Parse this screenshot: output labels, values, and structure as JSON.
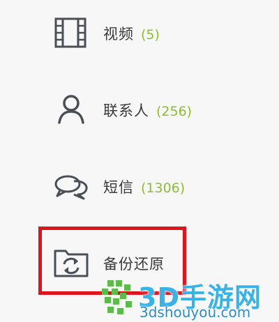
{
  "sidebar": {
    "items": [
      {
        "label": "视频",
        "count": "(5)",
        "icon": "film-icon"
      },
      {
        "label": "联系人",
        "count": "(256)",
        "icon": "person-icon"
      },
      {
        "label": "短信",
        "count": "(1306)",
        "icon": "chat-bubbles-icon"
      },
      {
        "label": "备份还原",
        "count": "",
        "icon": "backup-restore-icon"
      }
    ]
  },
  "watermark": {
    "brand": "3D手游网",
    "domain": "3dshouyou.com"
  },
  "colors": {
    "count_green": "#8bbf2f",
    "highlight_red": "#e0141d",
    "watermark_blue": "#38b3e8"
  }
}
